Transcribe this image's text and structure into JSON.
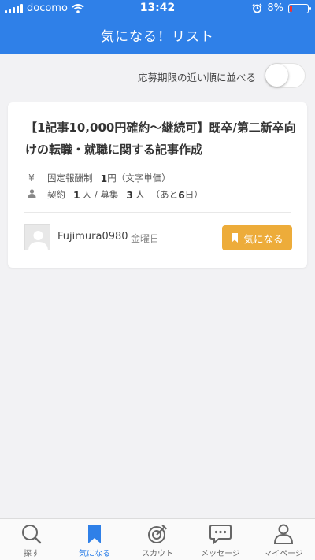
{
  "status_bar": {
    "carrier": "docomo",
    "time": "13:42",
    "battery": "8%"
  },
  "header": {
    "title": "気になる！リスト"
  },
  "sort": {
    "label": "応募期限の近い順に並べる",
    "enabled": false
  },
  "job": {
    "title": "【1記事10,000円確約〜継続可】既卒/第二新卒向けの転職・就職に関する記事作成",
    "pay_icon": "¥",
    "pay_type": "固定報酬制",
    "pay_amount": "1",
    "pay_unit": "円（文字単価）",
    "contract_label": "契約",
    "contract_count": "1",
    "contract_unit": "人 / 募集",
    "recruit_count": "3",
    "recruit_unit": "人",
    "remaining_prefix": "（あと",
    "remaining_days": "6",
    "remaining_suffix": "日）",
    "username": "Fujimura0980",
    "posted_day": "金曜日",
    "fav_label": "気になる"
  },
  "tabs": [
    {
      "label": "探す",
      "icon": "search-icon"
    },
    {
      "label": "気になる",
      "icon": "bookmark-icon",
      "active": true
    },
    {
      "label": "スカウト",
      "icon": "target-icon"
    },
    {
      "label": "メッセージ",
      "icon": "chat-icon"
    },
    {
      "label": "マイページ",
      "icon": "person-icon"
    }
  ],
  "colors": {
    "primary": "#2f80e8",
    "accent": "#edac3a",
    "battery_low": "#e33333"
  }
}
